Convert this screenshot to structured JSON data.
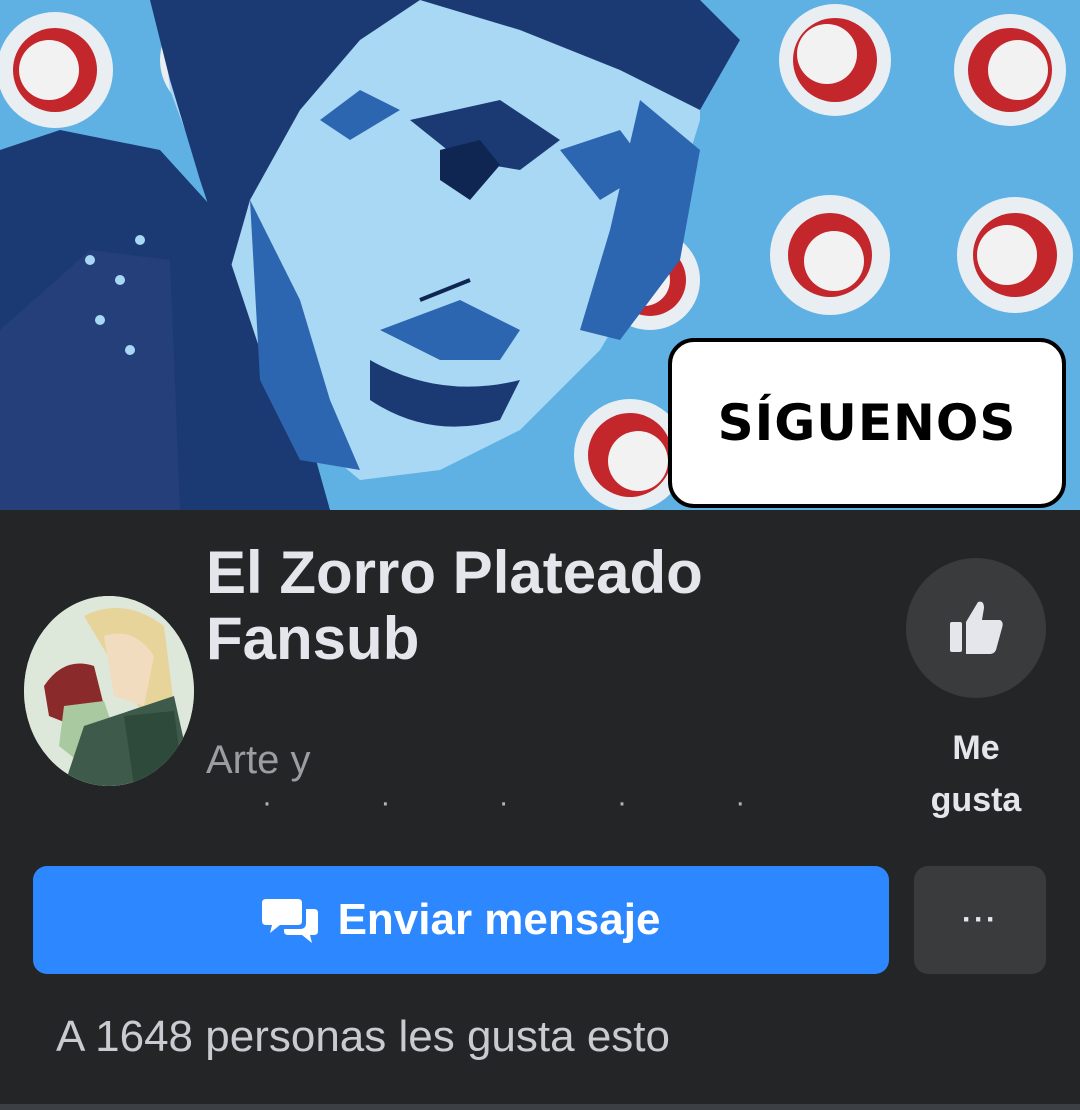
{
  "cover": {
    "badge_text": "SÍGUENOS",
    "colors": {
      "background": "#5fb1e4",
      "dark_blue": "#1b3a73",
      "mid_blue": "#2c66b0",
      "light_blue": "#a9d8f5",
      "ring_red": "#c3262b"
    }
  },
  "page": {
    "name": "El Zorro Plateado Fansub",
    "category": "Arte y",
    "category_dots": "· · · · ·"
  },
  "actions": {
    "like_label": "Me gusta",
    "message_label": "Enviar mensaje",
    "more_label": "···"
  },
  "likes_text": "A 1648 personas les gusta esto",
  "icons": {
    "like": "thumbs-up-icon",
    "message": "messenger-chat-icon",
    "more": "more-options-icon"
  }
}
